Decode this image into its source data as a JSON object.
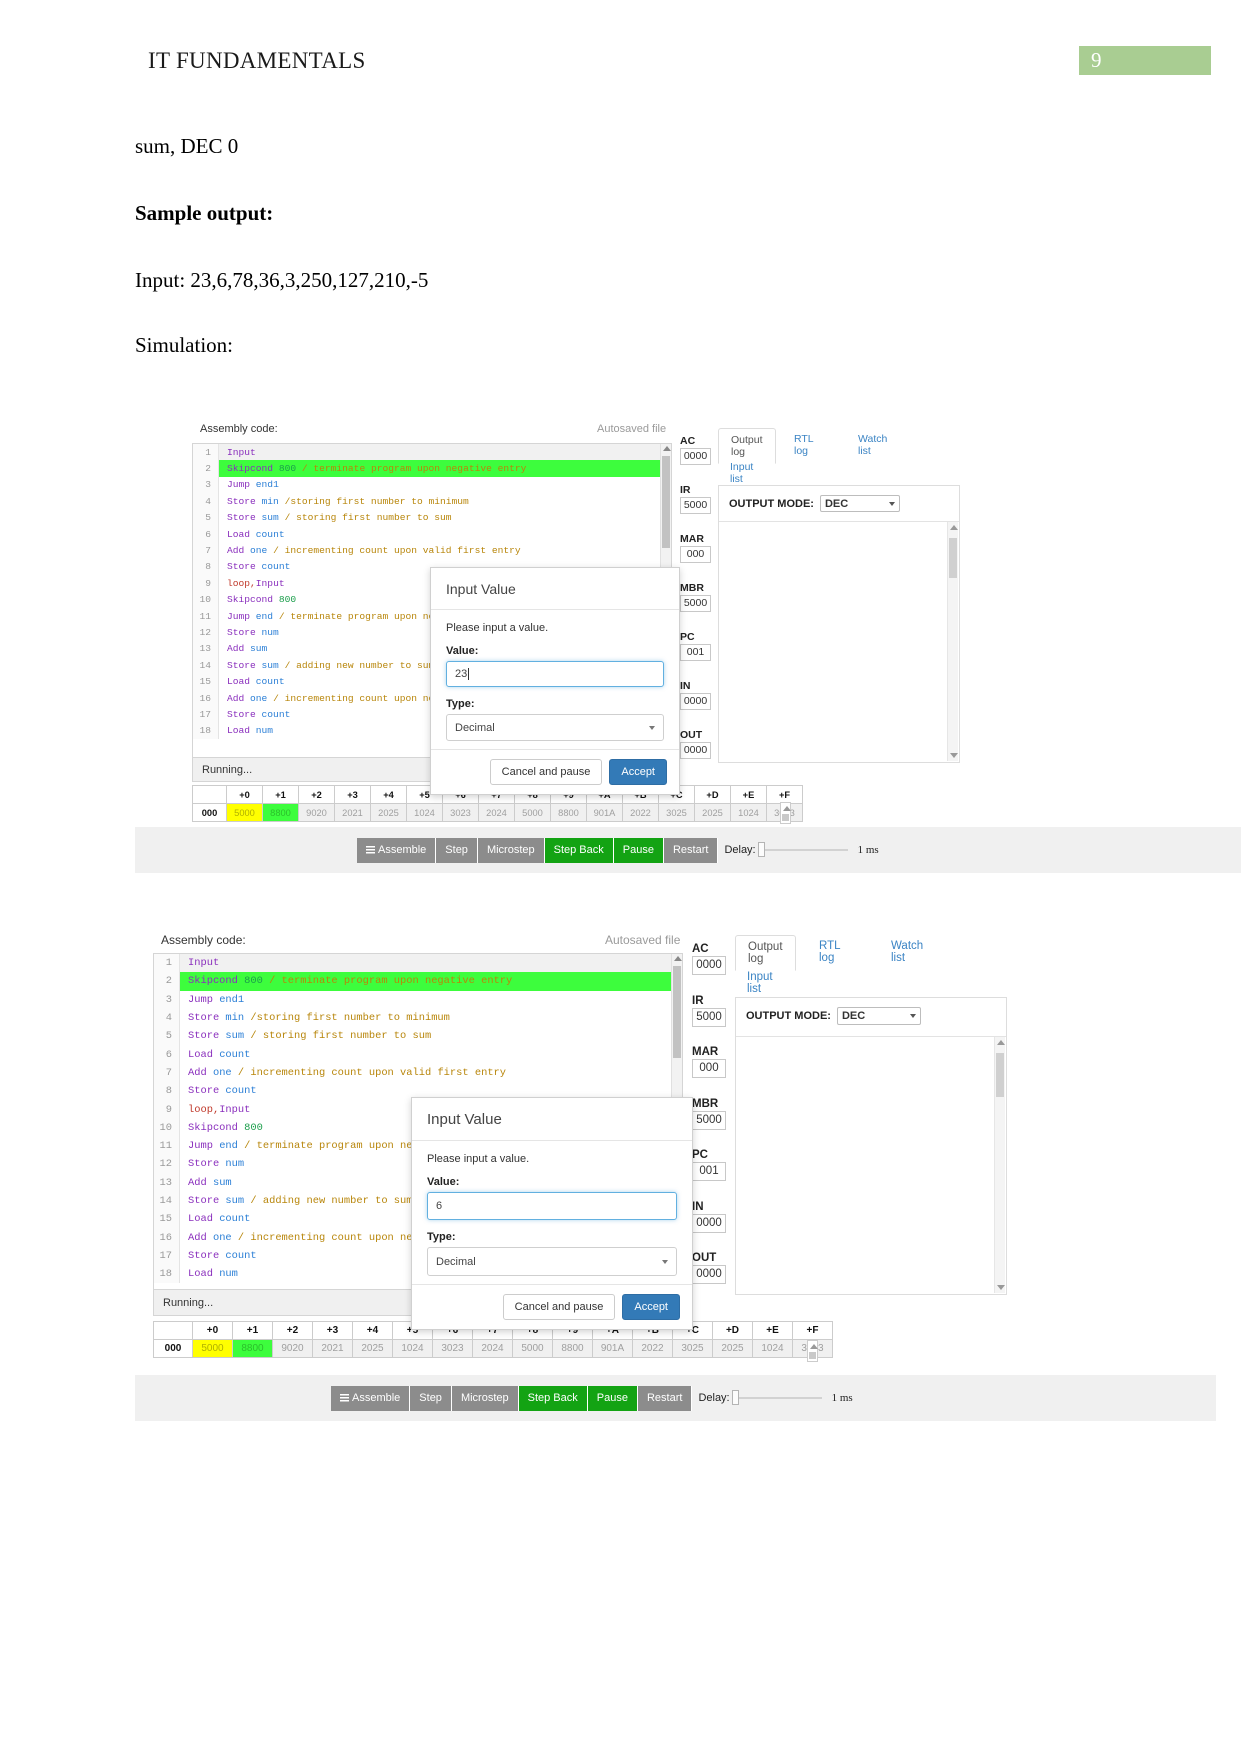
{
  "document": {
    "header_title": "IT FUNDAMENTALS",
    "page_number": "9",
    "line_sum": "sum, DEC 0",
    "line_sample": "Sample output:",
    "line_input": "Input: 23,6,78,36,3,250,127,210,-5",
    "line_simulation": "Simulation:"
  },
  "simulator": {
    "assembly_label": "Assembly code:",
    "autosaved_label": "Autosaved file",
    "status_text": "Running...",
    "code_lines": [
      {
        "n": "1",
        "segments": [
          {
            "t": "Input",
            "c": "kw"
          }
        ],
        "state": "cur"
      },
      {
        "n": "2",
        "segments": [
          {
            "t": "Skipcond ",
            "c": "kw"
          },
          {
            "t": "800",
            "c": "num"
          },
          {
            "t": " / terminate program upon negative entry",
            "c": "cmt"
          }
        ],
        "state": "hl"
      },
      {
        "n": "3",
        "segments": [
          {
            "t": "Jump ",
            "c": "kw"
          },
          {
            "t": "end1",
            "c": "op"
          }
        ],
        "state": ""
      },
      {
        "n": "4",
        "segments": [
          {
            "t": "Store ",
            "c": "kw"
          },
          {
            "t": "min ",
            "c": "op"
          },
          {
            "t": "/storing first number to minimum",
            "c": "cmt"
          }
        ],
        "state": ""
      },
      {
        "n": "5",
        "segments": [
          {
            "t": "Store ",
            "c": "kw"
          },
          {
            "t": "sum ",
            "c": "op"
          },
          {
            "t": "/ storing first number to sum",
            "c": "cmt"
          }
        ],
        "state": ""
      },
      {
        "n": "6",
        "segments": [
          {
            "t": "Load ",
            "c": "kw"
          },
          {
            "t": "count",
            "c": "op"
          }
        ],
        "state": ""
      },
      {
        "n": "7",
        "segments": [
          {
            "t": "Add ",
            "c": "kw"
          },
          {
            "t": "one ",
            "c": "op"
          },
          {
            "t": "/ incrementing count upon valid first entry",
            "c": "cmt"
          }
        ],
        "state": ""
      },
      {
        "n": "8",
        "segments": [
          {
            "t": "Store ",
            "c": "kw"
          },
          {
            "t": "count",
            "c": "op"
          }
        ],
        "state": ""
      },
      {
        "n": "9",
        "segments": [
          {
            "t": "loop,",
            "c": "lbl"
          },
          {
            "t": "Input",
            "c": "kw"
          }
        ],
        "state": ""
      },
      {
        "n": "10",
        "segments": [
          {
            "t": "Skipcond ",
            "c": "kw"
          },
          {
            "t": "800",
            "c": "num"
          }
        ],
        "state": ""
      },
      {
        "n": "11",
        "segments": [
          {
            "t": "Jump ",
            "c": "kw"
          },
          {
            "t": "end ",
            "c": "op"
          },
          {
            "t": "/ terminate program upon ne",
            "c": "cmt"
          }
        ],
        "state": ""
      },
      {
        "n": "12",
        "segments": [
          {
            "t": "Store ",
            "c": "kw"
          },
          {
            "t": "num",
            "c": "op"
          }
        ],
        "state": ""
      },
      {
        "n": "13",
        "segments": [
          {
            "t": "Add ",
            "c": "kw"
          },
          {
            "t": "sum",
            "c": "op"
          }
        ],
        "state": ""
      },
      {
        "n": "14",
        "segments": [
          {
            "t": "Store ",
            "c": "kw"
          },
          {
            "t": "sum ",
            "c": "op"
          },
          {
            "t": "/ adding new number to sum",
            "c": "cmt"
          }
        ],
        "state": ""
      },
      {
        "n": "15",
        "segments": [
          {
            "t": "Load ",
            "c": "kw"
          },
          {
            "t": "count",
            "c": "op"
          }
        ],
        "state": ""
      },
      {
        "n": "16",
        "segments": [
          {
            "t": "Add ",
            "c": "kw"
          },
          {
            "t": "one ",
            "c": "op"
          },
          {
            "t": "/ incrementing count upon ne",
            "c": "cmt"
          }
        ],
        "state": ""
      },
      {
        "n": "17",
        "segments": [
          {
            "t": "Store ",
            "c": "kw"
          },
          {
            "t": "count",
            "c": "op"
          }
        ],
        "state": ""
      },
      {
        "n": "18",
        "segments": [
          {
            "t": "Load ",
            "c": "kw"
          },
          {
            "t": "num",
            "c": "op"
          }
        ],
        "state": ""
      }
    ],
    "registers": [
      {
        "name": "AC",
        "value": "0000"
      },
      {
        "name": "IR",
        "value": "5000"
      },
      {
        "name": "MAR",
        "value": "000"
      },
      {
        "name": "MBR",
        "value": "5000"
      },
      {
        "name": "PC",
        "value": "001"
      },
      {
        "name": "IN",
        "value": "0000"
      },
      {
        "name": "OUT",
        "value": "0000"
      }
    ],
    "tabs": [
      {
        "label": "Output log",
        "active": true
      },
      {
        "label": "RTL log",
        "active": false
      },
      {
        "label": "Watch list",
        "active": false
      },
      {
        "label": "Input list",
        "active": false
      }
    ],
    "output_mode_label": "OUTPUT MODE:",
    "output_mode_value": "DEC",
    "memory": {
      "col_headers": [
        "",
        "+0",
        "+1",
        "+2",
        "+3",
        "+4",
        "+5",
        "+6",
        "+7",
        "+8",
        "+9",
        "+A",
        "+B",
        "+C",
        "+D",
        "+E",
        "+F"
      ],
      "row_label": "000",
      "cells": [
        {
          "v": "5000",
          "s": "yellow"
        },
        {
          "v": "8800",
          "s": "green"
        },
        {
          "v": "9020",
          "s": "dim"
        },
        {
          "v": "2021",
          "s": "dim"
        },
        {
          "v": "2025",
          "s": "dim"
        },
        {
          "v": "1024",
          "s": "dim"
        },
        {
          "v": "3023",
          "s": "dim"
        },
        {
          "v": "2024",
          "s": "dim"
        },
        {
          "v": "5000",
          "s": "dim"
        },
        {
          "v": "8800",
          "s": "dim"
        },
        {
          "v": "901A",
          "s": "dim"
        },
        {
          "v": "2022",
          "s": "dim"
        },
        {
          "v": "3025",
          "s": "dim"
        },
        {
          "v": "2025",
          "s": "dim"
        },
        {
          "v": "1024",
          "s": "dim"
        },
        {
          "v": "3023",
          "s": "dim"
        }
      ]
    },
    "toolbar": {
      "assemble": "Assemble",
      "step": "Step",
      "microstep": "Microstep",
      "step_back": "Step Back",
      "pause": "Pause",
      "restart": "Restart",
      "delay_label": "Delay:",
      "delay_value": "1 ms"
    },
    "modal": {
      "title": "Input Value",
      "prompt": "Please input a value.",
      "value_label": "Value:",
      "type_label": "Type:",
      "type_value": "Decimal",
      "cancel_label": "Cancel and pause",
      "accept_label": "Accept"
    }
  },
  "sim1": {
    "modal_value": "23"
  },
  "sim2": {
    "modal_value": "6"
  },
  "colors": {
    "accent_blue": "#337ab7",
    "highlight_green": "#3dfd3d",
    "highlight_yellow": "#ffff00",
    "page_badge_green": "#a9cd92",
    "button_grey": "#8c8c8c",
    "button_green": "#13a313"
  }
}
